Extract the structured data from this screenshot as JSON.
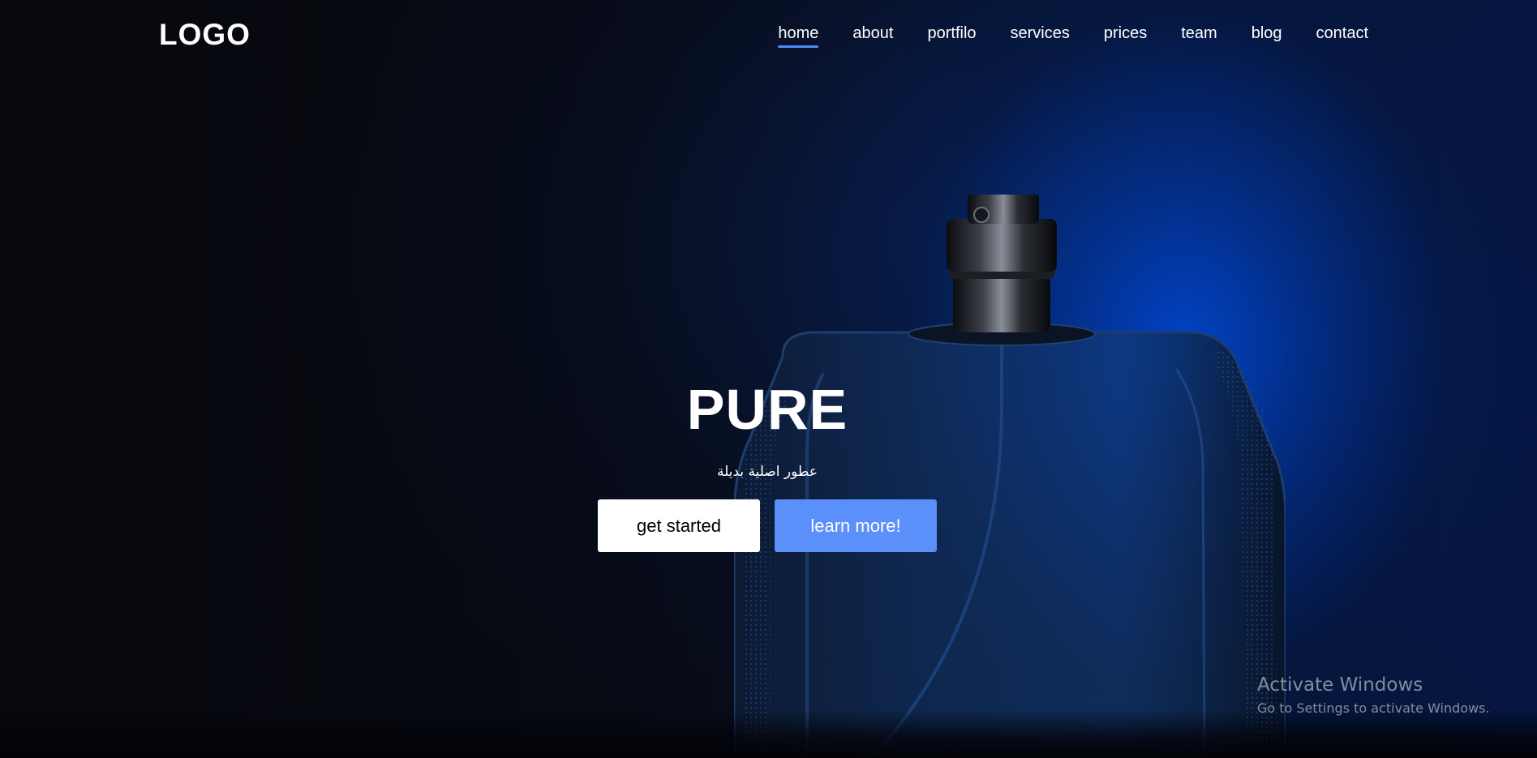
{
  "header": {
    "logo": "LOGO",
    "nav": [
      {
        "label": "home",
        "active": true
      },
      {
        "label": "about",
        "active": false
      },
      {
        "label": "portfilo",
        "active": false
      },
      {
        "label": "services",
        "active": false
      },
      {
        "label": "prices",
        "active": false
      },
      {
        "label": "team",
        "active": false
      },
      {
        "label": "blog",
        "active": false
      },
      {
        "label": "contact",
        "active": false
      }
    ]
  },
  "hero": {
    "title": "PURE",
    "subtitle": "عطور اصلية بديلة",
    "primary_button": "get started",
    "secondary_button": "learn more!"
  },
  "watermark": {
    "title": "Activate Windows",
    "subtitle": "Go to Settings to activate Windows."
  },
  "colors": {
    "accent": "#5b8ff9",
    "active_underline": "#4f8bf9",
    "background": "#07090f"
  },
  "image": {
    "subject_icon": "perfume-bottle"
  }
}
